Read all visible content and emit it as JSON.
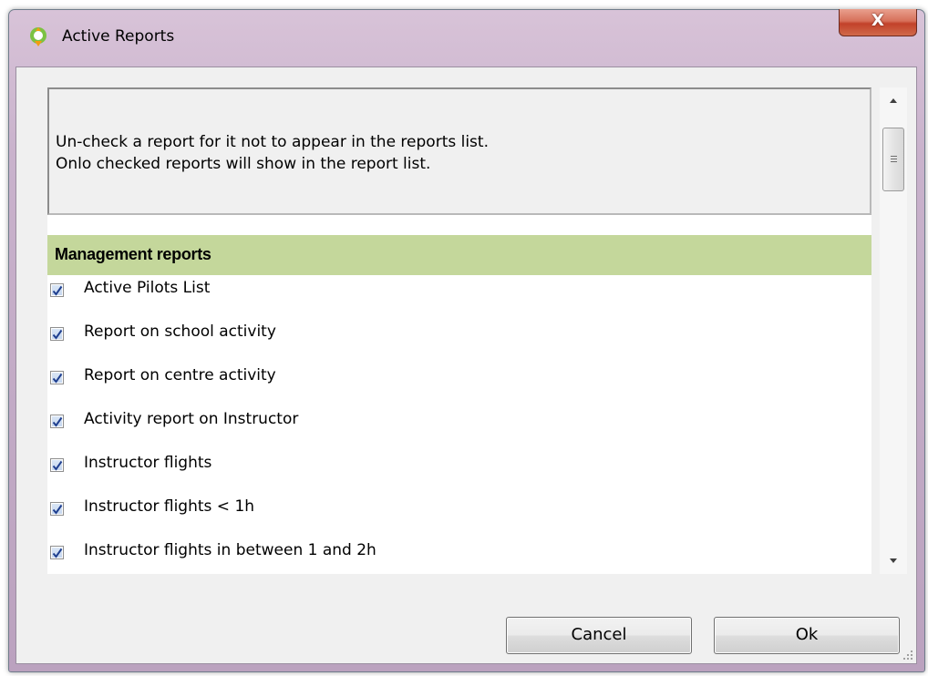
{
  "window": {
    "title": "Active Reports",
    "close_label": "X"
  },
  "info": {
    "line1": "Un-check a report for it not to appear in the reports list.",
    "line2": "Onlo checked reports will show in the report list."
  },
  "section": {
    "title": "Management reports"
  },
  "reports": [
    {
      "label": "Active Pilots List",
      "checked": true
    },
    {
      "label": "Report on school activity",
      "checked": true
    },
    {
      "label": "Report on centre activity",
      "checked": true
    },
    {
      "label": "Activity report on Instructor",
      "checked": true
    },
    {
      "label": "Instructor flights",
      "checked": true
    },
    {
      "label": "Instructor flights < 1h",
      "checked": true
    },
    {
      "label": "Instructor flights in between 1 and 2h",
      "checked": true
    }
  ],
  "buttons": {
    "cancel_label": "Cancel",
    "ok_label": "Ok"
  },
  "colors": {
    "section_header_bg": "#c4d79b",
    "checkbox_tick": "#1f3f8f"
  },
  "icons": {
    "app": "app-logo-icon",
    "close": "close-icon",
    "scroll_up": "scroll-up-arrow-icon",
    "scroll_down": "scroll-down-arrow-icon",
    "check": "checkmark-icon"
  }
}
